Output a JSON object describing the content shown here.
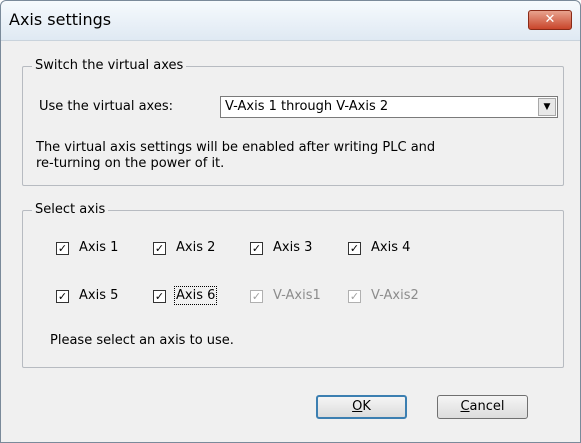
{
  "window": {
    "title": "Axis settings",
    "close_glyph": "✕"
  },
  "switch_group": {
    "legend": "Switch the virtual axes",
    "use_label": "Use the virtual axes:",
    "selected_option": "V-Axis 1 through V-Axis 2",
    "dropdown_glyph": "▼",
    "message_line1": "The virtual axis settings will be enabled after writing PLC and",
    "message_line2": "re-turning on the power of it."
  },
  "select_group": {
    "legend": "Select axis",
    "check_glyph": "✓",
    "axes": [
      {
        "label": "Axis 1",
        "checked": true,
        "enabled": true
      },
      {
        "label": "Axis 2",
        "checked": true,
        "enabled": true
      },
      {
        "label": "Axis 3",
        "checked": true,
        "enabled": true
      },
      {
        "label": "Axis 4",
        "checked": true,
        "enabled": true
      },
      {
        "label": "Axis 5",
        "checked": true,
        "enabled": true
      },
      {
        "label": "Axis 6",
        "checked": true,
        "enabled": true,
        "focused": true
      },
      {
        "label": "V-Axis1",
        "checked": true,
        "enabled": false
      },
      {
        "label": "V-Axis2",
        "checked": true,
        "enabled": false
      }
    ],
    "hint": "Please select an axis to use."
  },
  "buttons": {
    "ok_mnemonic": "O",
    "ok_rest": "K",
    "cancel_mnemonic": "C",
    "cancel_rest": "ancel"
  }
}
